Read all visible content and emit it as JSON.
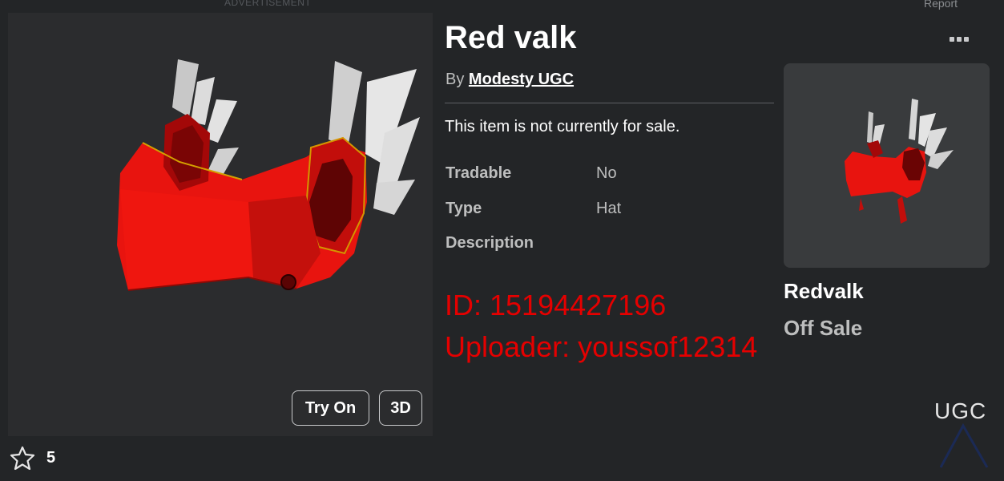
{
  "header": {
    "ad_label": "ADVERTISEMENT",
    "report_label": "Report"
  },
  "item": {
    "title": "Red valk",
    "by_prefix": "By",
    "creator": "Modesty UGC",
    "sale_note": "This item is not currently for sale.",
    "details": [
      {
        "label": "Tradable",
        "value": "No"
      },
      {
        "label": "Type",
        "value": "Hat"
      },
      {
        "label": "Description",
        "value": ""
      }
    ],
    "try_on_label": "Try On",
    "view_3d_label": "3D",
    "favorites": "5"
  },
  "overlay": {
    "id_text": "ID: 15194427196",
    "uploader_text": "Uploader: youssof12314",
    "color": "#e50000"
  },
  "bundle": {
    "name": "Redvalk",
    "status": "Off Sale"
  },
  "watermark": {
    "text": "UGC"
  },
  "icons": {
    "more": "more-dots-icon",
    "favorite": "star-outline-icon"
  },
  "colors": {
    "background": "#232527",
    "panel": "#2b2c2e",
    "card": "#393b3d",
    "accent_red": "#e50000",
    "hat_red": "#e8140f"
  }
}
